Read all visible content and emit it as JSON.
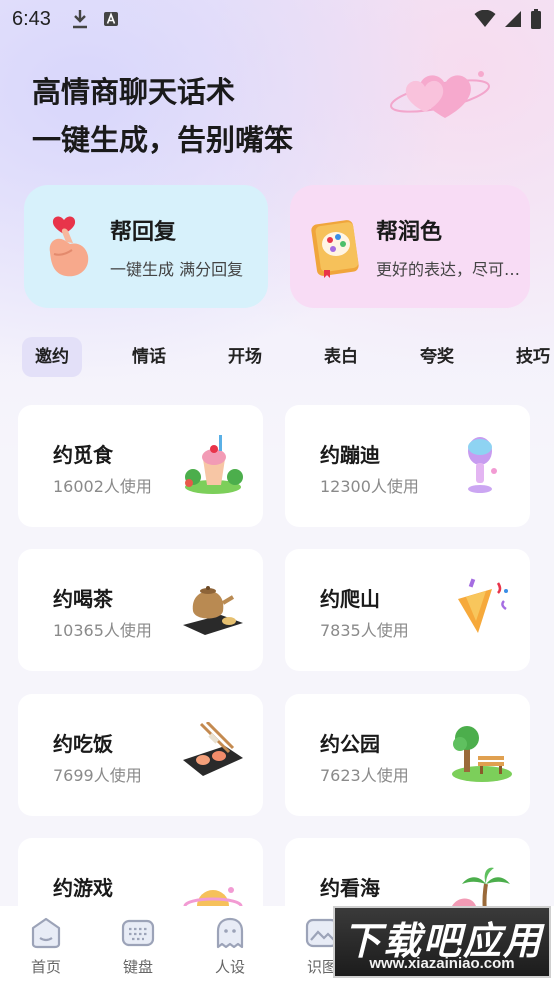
{
  "status_bar": {
    "time": "6:43"
  },
  "hero": {
    "line1": "高情商聊天话术",
    "line2": "一键生成，告别嘴笨"
  },
  "features": [
    {
      "title": "帮回复",
      "subtitle": "一键生成 满分回复",
      "icon": "finger-heart-icon"
    },
    {
      "title": "帮润色",
      "subtitle": "更好的表达，尽可能地",
      "icon": "palette-book-icon"
    }
  ],
  "tabs": [
    "邀约",
    "情话",
    "开场",
    "表白",
    "夸奖",
    "技巧"
  ],
  "active_tab": "邀约",
  "cards": [
    {
      "title": "约觅食",
      "usage": "16002人使用",
      "icon": "food-icon"
    },
    {
      "title": "约蹦迪",
      "usage": "12300人使用",
      "icon": "microphone-icon"
    },
    {
      "title": "约喝茶",
      "usage": "10365人使用",
      "icon": "teapot-icon"
    },
    {
      "title": "约爬山",
      "usage": "7835人使用",
      "icon": "party-popper-icon"
    },
    {
      "title": "约吃饭",
      "usage": "7699人使用",
      "icon": "sushi-icon"
    },
    {
      "title": "约公园",
      "usage": "7623人使用",
      "icon": "park-bench-icon"
    },
    {
      "title": "约游戏",
      "usage": "",
      "icon": "planet-icon"
    },
    {
      "title": "约看海",
      "usage": "",
      "icon": "palm-tree-icon"
    }
  ],
  "bottom_nav": [
    {
      "label": "首页",
      "icon": "home-icon"
    },
    {
      "label": "键盘",
      "icon": "keyboard-icon"
    },
    {
      "label": "人设",
      "icon": "ghost-icon"
    },
    {
      "label": "识图",
      "icon": "image-icon"
    }
  ],
  "watermark": {
    "main": "下载吧应用",
    "sub": "www.xiazainiao.com"
  },
  "colors": {
    "reply_card": "#d7f1fb",
    "polish_card": "#f8dcf5",
    "active_tab": "#e3e0f8"
  }
}
